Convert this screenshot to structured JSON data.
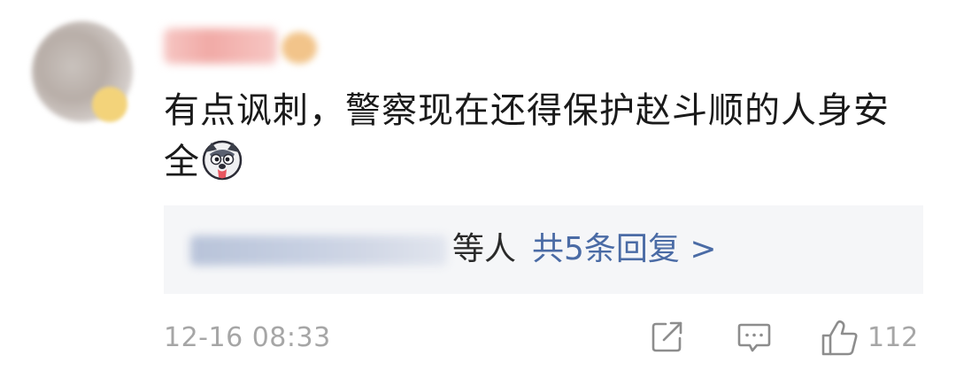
{
  "comment": {
    "text": "有点讽刺，警察现在还得保护赵斗顺的人身安全",
    "emoji": "husky-face-emoji",
    "timestamp": "12-16 08:33",
    "likes": "112"
  },
  "replies": {
    "others_suffix": "等人",
    "count_link": "共5条回复 >"
  },
  "icons": {
    "share": "share-icon",
    "reply": "comment-icon",
    "like": "thumbs-up-icon"
  },
  "colors": {
    "link": "#4a6ba5",
    "meta": "#a6a6a6",
    "reply_bg": "#f5f6f8"
  }
}
